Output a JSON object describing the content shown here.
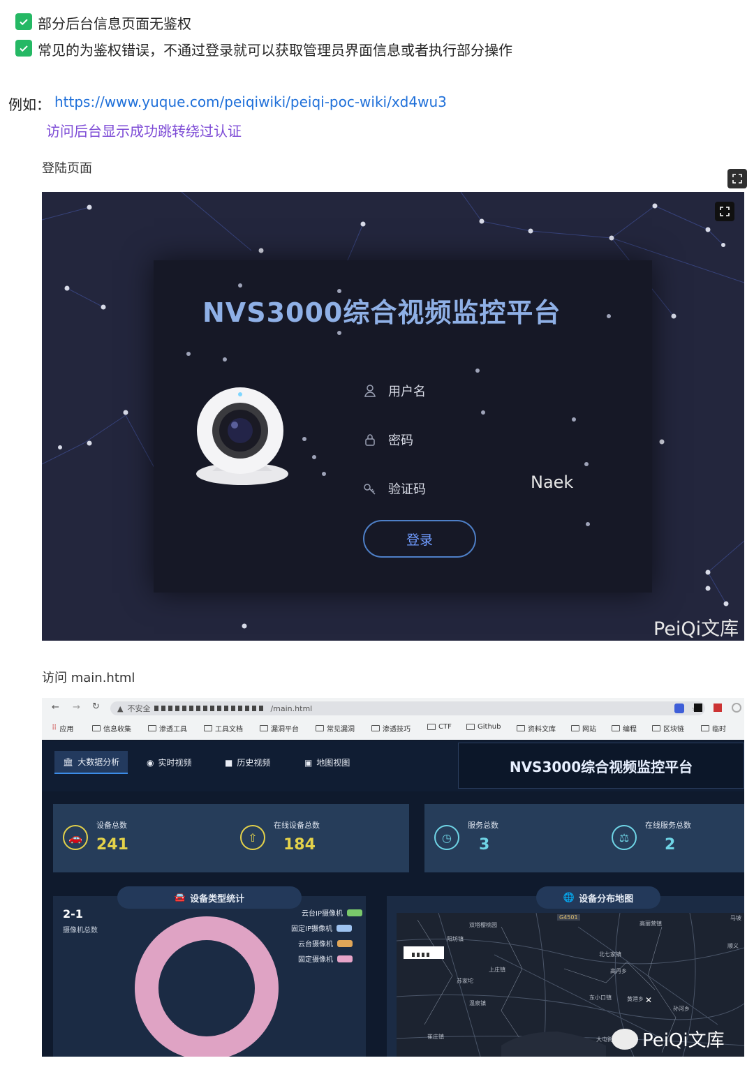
{
  "checklist": [
    "部分后台信息页面无鉴权",
    "常见的为鉴权错误，不通过登录就可以获取管理员界面信息或者执行部分操作"
  ],
  "example": {
    "label": "例如：",
    "url": "https://www.yuque.com/peiqiwiki/peiqi-poc-wiki/xd4wu3",
    "note": "访问后台显示成功跳转绕过认证"
  },
  "section1_caption": "登陆页面",
  "login_page": {
    "title": "NVS3000综合视频监控平台",
    "username_label": "用户名",
    "password_label": "密码",
    "captcha_label": "验证码",
    "captcha_value": "Naek",
    "login_button": "登录",
    "watermark": "PeiQi文库"
  },
  "section2_caption": "访问 main.html",
  "browser": {
    "security_label": "不安全",
    "url_suffix": "/main.html",
    "bookmarks": [
      "应用",
      "信息收集",
      "渗透工具",
      "工具文档",
      "漏洞平台",
      "常见漏洞",
      "渗透技巧",
      "CTF",
      "Github",
      "资料文库",
      "网站",
      "编程",
      "区块链",
      "临时"
    ]
  },
  "dashboard": {
    "tabs": [
      "大数据分析",
      "实时视频",
      "历史视频",
      "地图视图"
    ],
    "title": "NVS3000综合视频监控平台",
    "stats": [
      {
        "label": "设备总数",
        "value": "241",
        "color": "#e4d24a"
      },
      {
        "label": "在线设备总数",
        "value": "184",
        "color": "#e4d24a"
      },
      {
        "label": "服务总数",
        "value": "3",
        "color": "#6fd5e6"
      },
      {
        "label": "在线服务总数",
        "value": "2",
        "color": "#6fd5e6"
      }
    ],
    "device_panel": {
      "title": "设备类型统计",
      "camera_total_value": "2-1",
      "camera_total_label": "摄像机总数",
      "legend": [
        {
          "name": "云台IP摄像机",
          "color": "#7ac96b"
        },
        {
          "name": "固定IP摄像机",
          "color": "#9ec3f0"
        },
        {
          "name": "云台摄像机",
          "color": "#e0a658"
        },
        {
          "name": "固定摄像机",
          "color": "#e6a4c8"
        }
      ],
      "donut_color": "#dfa3c4"
    },
    "map_panel": {
      "title": "设备分布地图",
      "labels": [
        "G4501",
        "双塔樱桃园",
        "阳坊镇",
        "高丽营镇",
        "北七家镇",
        "上庄镇",
        "苏家坨",
        "温泉镇",
        "高丹乡",
        "东小口镇",
        "黄港乡",
        "孙河乡",
        "大屯街",
        "崔庄镇",
        "顺义",
        "马坡"
      ]
    },
    "watermark": "PeiQi文库"
  }
}
